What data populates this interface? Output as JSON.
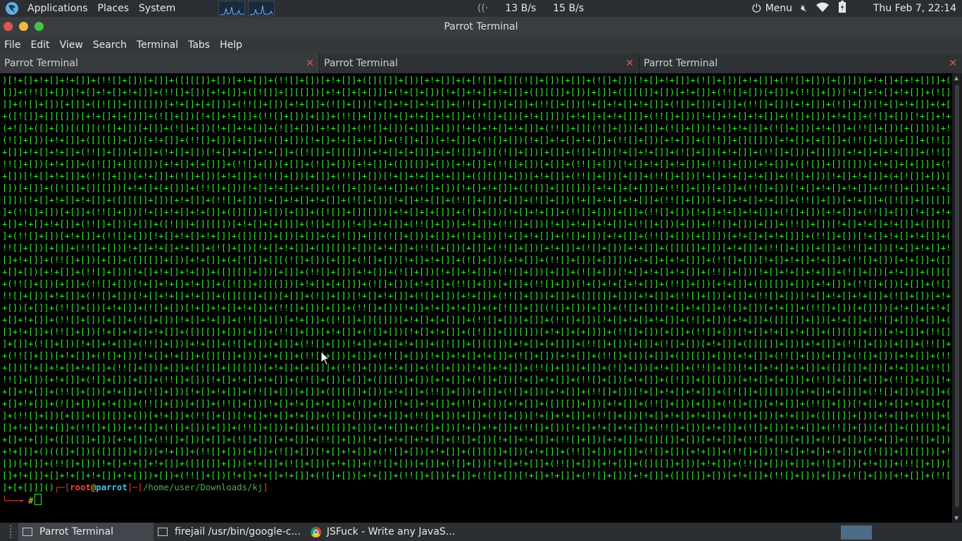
{
  "top_panel": {
    "menus": [
      "Applications",
      "Places",
      "System"
    ],
    "net_down": "13 B/s",
    "net_up": "15 B/s",
    "menu_label": "Menu",
    "clock": "Thu Feb  7, 22:14"
  },
  "window": {
    "title": "Parrot Terminal"
  },
  "menubar": {
    "items": [
      "File",
      "Edit",
      "View",
      "Search",
      "Terminal",
      "Tabs",
      "Help"
    ]
  },
  "tabs": [
    {
      "label": "Parrot Terminal"
    },
    {
      "label": "Parrot Terminal"
    },
    {
      "label": "Parrot Terminal"
    }
  ],
  "terminal": {
    "output_lines": [
      ")[!+[]+!+[]+!+[]]+(!![]+[])[+[]]+([][[]]+[])[+!+[]]+(!![]+[])[+!+[]]+([][[]]+[])[+!+[]]+(+[![]]+[][(![]+[])[+[]]+(![]+[])[!+[]+!+[]]+(![]+[])[+!+[]]+(!![]+[])[+[]]])[+!+[]+[+!+[]]]+(!![]+[])[!+[]+!+[]+!+[]]+(!![]+[])[+",
      "[]]+(!![]+[])[!+[]+!+[]+!+[]]+(!![]+[])[+!+[]]+([![]]+[][[]])[+!+[]+[+[]]]+(!+[]+[])[!+[]+!+[]+!+[]]+([][[]]+[])[+[]]+([][[]]+[])[+!+[]]+(!![]+[])[+[]]+(!![]+[])[!+[]+!+[]+!+[]]+(![]+[])[!+[]+!+[]]+([![]]+[][[]])[",
      "]]+(![]+[])[+[]]+([![]]+[][[]])[+!+[]+[+[]]]+(!![]+[])[+!+[]]+(![]+[])[!+[]+!+[]+!+[]]+(!![]+[])[+[]]+(!![]+[])[!+[]+!+[]+!+[]]+(![]+[])[+[]]+(!![]+[])[+!+[]]+(![]+[])[!+[]+!+[]]+(+[![]]+[][(![]+[])[+[]]",
      "+([![]]+[][[]])[+!+[]+[+[]]]+(![]+[])[!+[]+!+[]]+(!![]+[])[+[]]+(!![]+[])[!+[]+!+[]+!+[]]+(!![]+[])[+!+[]]])[+!+[]+[+!+[]]]+(!![]+[])[!+[]+!+[]+!+[]]+(![]+[])[+!+[]]+(![]+[])[!+[]+!+[]]+([][[]]+[])[!+[]+!+[]]+",
      "(+![]+([]+[])[([][(![]+[])[+[]]+(![]+[])[!+[]+!+[]]+(![]+[])[+!+[]]+(!![]+[])[+[]]]+[])[!+[]+!+[]+!+[]]+(!![]+[][(![]+[])[+[]]+(![]+[])[!+[]+!+[]]+(![]+[])[+!+[]]+(!![]+[])[+[]]])[+!+[]+[+[]]]+([][[]]+[])[+!+[]]+(",
      "(![]+[])[+!+[]]+([][[]]+[])[+!+[]]+(!![]+[])[+[]]+(![]+[])[!+[]+!+[]+!+[]]+(![]+[])[+!+[]]+(!![]+[])[!+[]+!+[]+!+[]]+(!![]+[])[+!+[]]+([![]]+[][[]])[+!+[]+[+[]]]+(!![]+[])[+[]]+(!![]+[])[!+[]+!+[]+!+[]]+(+",
      "+[]]+!+[]+!+[]+(!![]+[])[+[]]+(!+[]+[])[!+[]+!+[]+!+[]]+([![]]+[][[]])[+!+[]+[+[]]]+(+[![]]+[][(![]+[])[+[]]+(![]+[])[!+[]+!+[]]+(![]+[])[+!+[]]+(!![]+[])[+[]]])[+!+[]+[+!+[]]]+(!![]+[])[!+[]+!+[]+!+[]]+(+",
      "!![]+[])[+!+[]]+([![]]+[][[]])[+!+[]+[+[]]]+(!![]+[])[+[]]+(![]+[])[+!+[]]+([][[]]+[])[+!+[]]+(!![]+[])[+[]]+(!![]+[])[!+[]+!+[]+!+[]]+(!![]+[])[+!+[]]+([![]]+[][[]])[+!+[]+[+[]]]+(![]+[])[!+[]+!+[]]+(!![]+",
      "+[])[!+[]+!+[]]+(!![]+[])[+!+[]]+(![]+[])[+!+[]]+(!![]+[])[+[]]+(!![]+[])[!+[]+!+[]+!+[]]+([][[]]+[])[+!+[]]+(!![]+[])[+[]]+(!![]+[])[!+[]+!+[]+!+[]]+(![]+[])[!+[]+!+[]]+(+[![]]+[])[+!+[]]+(!![]+[])[+[]]+([",
      "[])[+[]]+([![]]+[][[]])[+!+[]+[+[]]]+(!![]+[])[!+[]+!+[]+!+[]]+(![]+[])[+!+[]]+(![]+[])[!+[]+!+[]]+([![]]+[][[]])[+!+[]+[+[]]]+(!![]+[])[+[]]+(!![]+[])[!+[]+!+[]+!+[]]+(!![]+[])[+!+[]]+([][[]]+[])[+!+[]]+",
      "[]])[!+[]+!+[]+!+[]]+([][[]]+[])[+!+[]]+(!![]+[])[!+[]+!+[]+!+[]]+(![]+[])[!+[]+!+[]]+(!![]+[])[+[]]+(![]+[])[!+[]+!+[]+!+[]]+(!![]+[])[!+[]+!+[]+!+[]]+(!![]+[])[+!+[]]+([![]]+[][[]])[+!+[]+[+[]]]+(![]+[",
      "]+(!![]+[])[+[]]+(!![]+[])[!+[]+!+[]+!+[]]+([][[]]+[])[+[]]+([![]]+[][[]])[+!+[]+[+[]]]+(![]+[])[!+[]+!+[]]+(!![]+[])[+[]]+(!![]+[])[!+[]+!+[]+!+[]]+(![]+[])[+!+[]]+(!![]+[])[!+[]+!+[]+!+[]]+(!![]+[])[+[",
      "+[]+!+[]+!+[]]+(!![]+[])[+[]]+([![]]+[][[]])[+!+[]+[+[]]]+(![]+[])[!+[]+!+[]]+(!![]+[])[+!+[]]+(!![]+[])[!+[]+!+[]+!+[]]+(![]+[])[+[]]+(!![]+[])[+[]]+(!![]+[])[!+[]+!+[]+!+[]]+([][[]]+[])[+!+[]]+(!![]+[",
      "]+(!![]+[])[+!+[]]+(!![]+[])[!+[]+!+[]+!+[]]+([][[]]+[])[+[]]+(+[![]]+[][(![]+[])[+[]]+(![]+[])[!+[]+!+[]]+(![]+[])[+!+[]]+(!![]+[])[+[]]])[+!+[]+[+!+[]]]+(!![]+[])[!+[]+!+[]+!+[]]+(![]+[])[+!+[]]+(",
      "!![]+[])[+[]]+(!![]+[])[!+[]+!+[]+!+[]]+(![]+[])[!+[]+!+[]]+([][[]]+[])[+!+[]]+(!![]+[])[+[]]+(!![]+[])[+!+[]]+(![]+[])[+!+[]]+([][[]]+[])[+!+[]]+(!![]+[])[+[]]+(!![]+[])[!+[]+!+[]+!+[]]+(![]+[])[!+[]+!",
      "[]+!+[]]+(!![]+[])[+[]]+([][[]]+[])[+!+[]]+(+[![]]+[][(![]+[])[+[]]+(![]+[])[!+[]+!+[]]+(![]+[])[+!+[]]+(!![]+[])[+[]]])[+!+[]+[+!+[]]]+(!![]+[])[!+[]+!+[]+!+[]]+(!![]+[])[+!+[]]+([][[]]+[])[+!+[]]+(!",
      "+[]+[])[+!+[]]+(!![]+[])[!+[]+!+[]+!+[]]+([][[]]+[])[+[]]+(!![]+[])[+!+[]]+(![]+[])[!+[]+!+[]]+(!![]+[])[+[]]+(![]+[])[!+[]+!+[]+!+[]]+(!![]+[])[!+[]+!+[]+!+[]]+(![]+[])[+!+[]]+([][[]]+[])[+!+[]]+(!![]+[",
      "+(!![]+[])[+[]]+(!![]+[])[!+[]+!+[]+!+[]]+([![]]+[][[]])[+!+[]+[+[]]]+(![]+[])[+!+[]]+(!![]+[])[+[]]+(!![]+[])[!+[]+!+[]+!+[]]+(!![]+[])[+!+[]]+([][[]]+[])[+!+[]]+(!![]+[])[+[]]+(![]+[])[+!+[]]+(!![]+[",
      "!![]+[])[+!+[]]+(!![]+[])[!+[]+!+[]+!+[]]+([][[]]+[])[+[]]+(![]+[])[!+[]+!+[]]+(![]+[])[+!+[]]+(!![]+[])[+[]]+([][[]]+[])[+!+[]]+(!![]+[])[+[]]+(!![]+[])[!+[]+!+[]+!+[]]+(![]+[])[+!+[]]+(!![]+[])[!+[]+!",
      "+[])[+[]]+(!![]+[])[+!+[]]+(![]+[])[!+[]+!+[]+!+[]]+(!![]+[])[+[]]+(!![]+[])[!+[]+!+[]+!+[]]+(+[![]]+[][(![]+[])[+[]]+(![]+[])[!+[]+!+[]]+(![]+[])[+!+[]]+(!![]+[])[+[]]])[+!+[]+[+!+[]]]+(![]+[])[+!+[]",
      "+[]+!+[]]+(!![]+[])[+[]]+(![]+[])[!+[]+!+[]]+(!![]+[])[+!+[]]+([![]]+[][[]])[+!+[]+[+[]]]+(!![]+[])[+[]]+(!![]+[])[!+[]+!+[]+!+[]]+(![]+[])[+!+[]]+([][[]]+[])[+!+[]]+(!![]+[])[+[]]+(![]+[])[!+[]+!+[]]+(",
      "[]+!+[]]+(!![]+[])[!+[]+!+[]+!+[]]+([][[]]+[])[+[]]+(!![]+[])[+!+[]]+(![]+[])[!+[]+!+[]]+([![]]+[][[]])[+!+[]+[+[]]]+(!![]+[])[+[]]+(!![]+[])[!+[]+!+[]+!+[]]+([][[]]+[])[+!+[]]+(!![]+[])[+[]]+(![]+[])[+",
      "]+[]]+(![]+[])[!+[]+!+[]]+(!![]+[])[+!+[]]+(![]+[])[+[]]+(!![]+[])[!+[]+!+[]+!+[]]+([![]]+[][[]])[+!+[]+[+[]]]+(!![]+[])[+[]]+(![]+[])[+!+[]]+([][[]]+[])[+!+[]]+(!![]+[])[+[]]+(!![]+[])[!+[]+!+[]+!+[]",
      "+(!![]+[])[+!+[]]+(![]+[])[!+[]+!+[]]+([][[]]+[])[+!+[]]+(!![]+[])[+[]]+(!![]+[])[!+[]+!+[]+!+[]]+(![]+[])[+!+[]]+(!![]+[])[+[]]+([][[]]+[])[+!+[]]+(!![]+[])[+[]]+(![]+[])[+!+[]]+(!![]+[])[!+[]+!+[]+!",
      "+[])[!+[]+!+[]+!+[]]+(!![]+[])[+[]]+([![]]+[][[]])[+!+[]+[+[]]]+(!![]+[])[+!+[]]+(![]+[])[!+[]+!+[]]+(!![]+[])[+[]]+(![]+[])[+!+[]]+(!![]+[])[!+[]+!+[]+!+[]]+([][[]]+[])[+!+[]]+(!![]+[])[+[]]+(![]+[])[+",
      "!![]+[])[+!+[]]+(![]+[])[+[]]+(!![]+[])[!+[]+!+[]+!+[]]+(!![]+[])[+[]]+([][[]]+[])[+!+[]]+(![]+[])[!+[]+!+[]]+(!![]+[])[+!+[]]+([![]]+[][[]])[+!+[]+[+[]]]+(!![]+[])[+[]]+(!![]+[])[!+[]+!+[]+!+[]]+(![]+[",
      "+[]+!+[]]+(!![]+[])[+!+[]]+(![]+[])[!+[]+!+[]]+(!![]+[])[+[]]+([][[]]+[])[+!+[]]+(!![]+[])[+[]]+(![]+[])[+!+[]]+(!![]+[])[!+[]+!+[]+!+[]]+([![]]+[][[]])[+!+[]+[+[]]]+(!![]+[])[+[]]+(!![]+[])[+!+[]]+(![",
      "+[]+!+[]]+(![]+[])[+!+[]]+(!![]+[])[+[]]+(!![]+[])[!+[]+!+[]+!+[]]+(![]+[])[!+[]+!+[]]+(!![]+[])[+!+[]]+([][[]]+[])[+!+[]]+(!![]+[])[+[]]+(![]+[])[+!+[]]+(!![]+[])[!+[]+!+[]+!+[]]+([![]]+[][[]])[+!+[]+",
      "]+(!![]+[])[+[]]+([][[]]+[])[+!+[]]+(!![]+[])[!+[]+!+[]+!+[]]+(![]+[])[+!+[]]+(!![]+[])[+[]]+(![]+[])[!+[]+!+[]]+(!![]+[])[!+[]+!+[]+!+[]]+(!![]+[])[+!+[]]+([][[]]+[])[+!+[]]+(!![]+[])[+[]]+(![]+[])[+!+",
      "[]+!+[]+!+[]]+(!![]+[])[+!+[]]+(![]+[])[+[]]+(!![]+[])[+[]]+([][[]]+[])[+!+[]]+(![]+[])[!+[]+!+[]]+(!![]+[])[!+[]+!+[]+!+[]]+(!![]+[])[+!+[]]+(![]+[])[+!+[]]+(!![]+[])[+[]]+([][[]]+[])[+!+[]]+(!![]+[",
      "+[]+!+[]]+([][[]]+[])[+!+[]]+(!![]+[])[+[]]+(![]+[])[+!+[]]+(!![]+[])[!+[]+!+[]+!+[]]+(![]+[])[!+[]+!+[]]+(!![]+[])[+!+[]]+([][[]]+[])[+!+[]]+(!![]+[])[+[]]+(![]+[])[+!+[]]+(!![]+[])[!+[]+!+[]+!+[]]+(",
      "+!+[]]+()(([]+[])[([][[]]+[])[+!+[]]+(!![]+[])[+[]]+(![]+[])[!+[]+!+[]]+(!![]+[])[+!+[]]+([][[]]+[])[+!+[]]+(!![]+[])[+[]]+(![]+[])[+!+[]]+(!![]+[])[!+[]+!+[]+!+[]]+([![]]+[][[]])[+!+[]+[+[]]]+(!![]+[",
      "[])[+[]]+(!![]+[])[!+[]+!+[]+!+[]]+([][[]]+[])[+!+[]]+(![]+[])[+!+[]]+(!![]+[])[+[]]+(![]+[])[!+[]+!+[]]+(!![]+[])[+!+[]]+([][[]]+[])[+!+[]]+(!![]+[])[+[]]+(![]+[])[+!+[]]+(!![]+[])[!+[]+!+[]+!+[]]+(!",
      "[]+!+[]]+[]+!+[]+!+[]]+!+[]])+[])+(!![]+[])[!+[]+!+[]+!+[]]+(![]+[])[+!+[]]+(!![]+[])[+[]]+(![]+[])[!+[]+!+[]]+(!![]+[])[+!+[]]+([][[]]+[])[+!+[]]+(!![]+[])[+[]]+(![]+[])[+!+[]]+(!![]+[])[!+[]+!+[]+!"
    ],
    "prompt_tail_before": "]+[+[]]]()",
    "prompt_box_open": "┌─[",
    "prompt_user": "root",
    "prompt_at": "@",
    "prompt_host": "parrot",
    "prompt_sep": "]─[",
    "prompt_path": "/home/user/Downloads/kj",
    "prompt_close": "]",
    "prompt_second": "└──╼ ",
    "prompt_symbol": "#"
  },
  "taskbar": {
    "tasks": [
      {
        "label": "Parrot Terminal"
      },
      {
        "label": "firejail /usr/bin/google-c..."
      },
      {
        "label": "JSFuck - Write any JavaS..."
      }
    ]
  },
  "colors": {
    "terminal_text": "#2ef02e",
    "panel_bg": "#2b2f33",
    "close_red": "#e25650"
  }
}
